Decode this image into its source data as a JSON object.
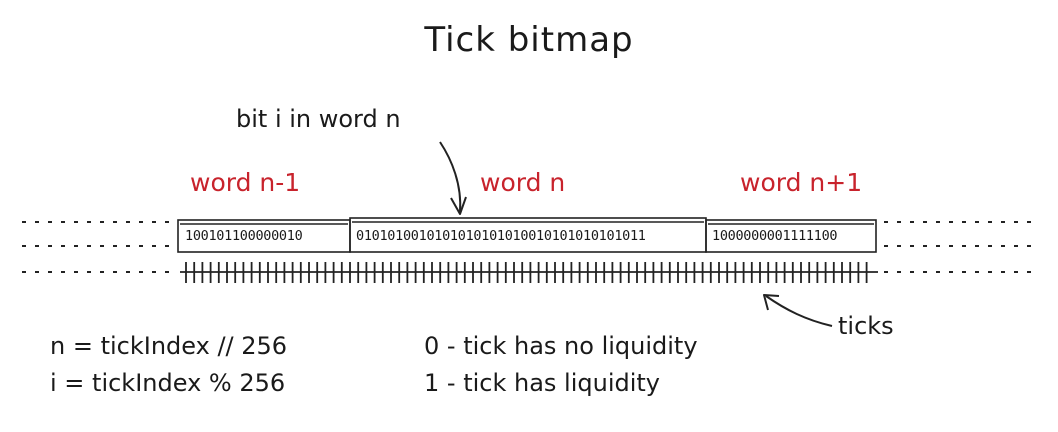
{
  "title": "Tick bitmap",
  "callout_label": "bit i in word n",
  "words": [
    {
      "label": "word n-1",
      "bits": "100101100000010"
    },
    {
      "label": "word n",
      "bits": "0101010010101010101010010101010101011"
    },
    {
      "label": "word n+1",
      "bits": "1000000001111100"
    }
  ],
  "ticks_label": "ticks",
  "formulas": [
    "n = tickIndex // 256",
    "i = tickIndex % 256"
  ],
  "legend": [
    "0 - tick has no liquidity",
    "1 - tick has liquidity"
  ],
  "colors": {
    "word_label": "#c8232c",
    "ink": "#1a1a1a"
  }
}
